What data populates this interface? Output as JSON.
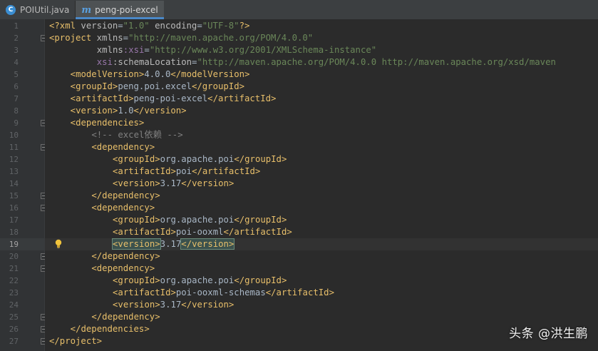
{
  "tabs": [
    {
      "label": "POIUtil.java",
      "icon": "class-c-icon",
      "active": false
    },
    {
      "label": "peng-poi-excel",
      "icon": "maven-m-icon",
      "active": true
    }
  ],
  "code_lines": [
    {
      "n": "1",
      "indent": 0,
      "tokens": [
        [
          "tag",
          "<?xml "
        ],
        [
          "attr",
          "version"
        ],
        [
          "txt",
          "="
        ],
        [
          "val",
          "\"1.0\""
        ],
        [
          "txt",
          " "
        ],
        [
          "attr",
          "encoding"
        ],
        [
          "txt",
          "="
        ],
        [
          "val",
          "\"UTF-8\""
        ],
        [
          "tag",
          "?>"
        ]
      ]
    },
    {
      "n": "2",
      "indent": 0,
      "tokens": [
        [
          "tag",
          "<project "
        ],
        [
          "attr",
          "xmlns"
        ],
        [
          "txt",
          "="
        ],
        [
          "val",
          "\"http://maven.apache.org/POM/4.0.0\""
        ]
      ]
    },
    {
      "n": "3",
      "indent": 9,
      "tokens": [
        [
          "attr",
          "xmlns"
        ],
        [
          "ns",
          ":xsi"
        ],
        [
          "txt",
          "="
        ],
        [
          "val",
          "\"http://www.w3.org/2001/XMLSchema-instance\""
        ]
      ]
    },
    {
      "n": "4",
      "indent": 9,
      "tokens": [
        [
          "ns",
          "xsi"
        ],
        [
          "attr",
          ":schemaLocation"
        ],
        [
          "txt",
          "="
        ],
        [
          "val",
          "\"http://maven.apache.org/POM/4.0.0 http://maven.apache.org/xsd/maven"
        ]
      ]
    },
    {
      "n": "5",
      "indent": 4,
      "tokens": [
        [
          "tag",
          "<modelVersion>"
        ],
        [
          "txt",
          "4.0.0"
        ],
        [
          "tag",
          "</modelVersion>"
        ]
      ]
    },
    {
      "n": "6",
      "indent": 4,
      "tokens": [
        [
          "tag",
          "<groupId>"
        ],
        [
          "txt",
          "peng.poi.excel"
        ],
        [
          "tag",
          "</groupId>"
        ]
      ]
    },
    {
      "n": "7",
      "indent": 4,
      "tokens": [
        [
          "tag",
          "<artifactId>"
        ],
        [
          "txt",
          "peng-poi-excel"
        ],
        [
          "tag",
          "</artifactId>"
        ]
      ]
    },
    {
      "n": "8",
      "indent": 4,
      "tokens": [
        [
          "tag",
          "<version>"
        ],
        [
          "txt",
          "1.0"
        ],
        [
          "tag",
          "</version>"
        ]
      ]
    },
    {
      "n": "9",
      "indent": 4,
      "tokens": [
        [
          "tag",
          "<dependencies>"
        ]
      ]
    },
    {
      "n": "10",
      "indent": 8,
      "tokens": [
        [
          "cm",
          "<!-- excel依赖 -->"
        ]
      ]
    },
    {
      "n": "11",
      "indent": 8,
      "tokens": [
        [
          "tag",
          "<dependency>"
        ]
      ]
    },
    {
      "n": "12",
      "indent": 12,
      "tokens": [
        [
          "tag",
          "<groupId>"
        ],
        [
          "txt",
          "org.apache.poi"
        ],
        [
          "tag",
          "</groupId>"
        ]
      ]
    },
    {
      "n": "13",
      "indent": 12,
      "tokens": [
        [
          "tag",
          "<artifactId>"
        ],
        [
          "txt",
          "poi"
        ],
        [
          "tag",
          "</artifactId>"
        ]
      ]
    },
    {
      "n": "14",
      "indent": 12,
      "tokens": [
        [
          "tag",
          "<version>"
        ],
        [
          "txt",
          "3.17"
        ],
        [
          "tag",
          "</version>"
        ]
      ]
    },
    {
      "n": "15",
      "indent": 8,
      "tokens": [
        [
          "tag",
          "</dependency>"
        ]
      ]
    },
    {
      "n": "16",
      "indent": 8,
      "tokens": [
        [
          "tag",
          "<dependency>"
        ]
      ]
    },
    {
      "n": "17",
      "indent": 12,
      "tokens": [
        [
          "tag",
          "<groupId>"
        ],
        [
          "txt",
          "org.apache.poi"
        ],
        [
          "tag",
          "</groupId>"
        ]
      ]
    },
    {
      "n": "18",
      "indent": 12,
      "tokens": [
        [
          "tag",
          "<artifactId>"
        ],
        [
          "txt",
          "poi-ooxml"
        ],
        [
          "tag",
          "</artifactId>"
        ]
      ]
    },
    {
      "n": "19",
      "indent": 12,
      "current": true,
      "tokens": [
        [
          "tag hl",
          "<version>"
        ],
        [
          "txt",
          "3.17"
        ],
        [
          "tag hl",
          "</version>"
        ]
      ]
    },
    {
      "n": "20",
      "indent": 8,
      "tokens": [
        [
          "tag",
          "</dependency>"
        ]
      ]
    },
    {
      "n": "21",
      "indent": 8,
      "tokens": [
        [
          "tag",
          "<dependency>"
        ]
      ]
    },
    {
      "n": "22",
      "indent": 12,
      "tokens": [
        [
          "tag",
          "<groupId>"
        ],
        [
          "txt",
          "org.apache.poi"
        ],
        [
          "tag",
          "</groupId>"
        ]
      ]
    },
    {
      "n": "23",
      "indent": 12,
      "tokens": [
        [
          "tag",
          "<artifactId>"
        ],
        [
          "txt",
          "poi-ooxml-schemas"
        ],
        [
          "tag",
          "</artifactId>"
        ]
      ]
    },
    {
      "n": "24",
      "indent": 12,
      "tokens": [
        [
          "tag",
          "<version>"
        ],
        [
          "txt",
          "3.17"
        ],
        [
          "tag",
          "</version>"
        ]
      ]
    },
    {
      "n": "25",
      "indent": 8,
      "tokens": [
        [
          "tag",
          "</dependency>"
        ]
      ]
    },
    {
      "n": "26",
      "indent": 4,
      "tokens": [
        [
          "tag",
          "</dependencies>"
        ]
      ]
    },
    {
      "n": "27",
      "indent": 0,
      "tokens": [
        [
          "tag",
          "</project>"
        ]
      ]
    }
  ],
  "fold_lines": [
    "2",
    "9",
    "11",
    "15",
    "16",
    "20",
    "21",
    "25",
    "26",
    "27"
  ],
  "watermark": "头条 @洪生鹏"
}
